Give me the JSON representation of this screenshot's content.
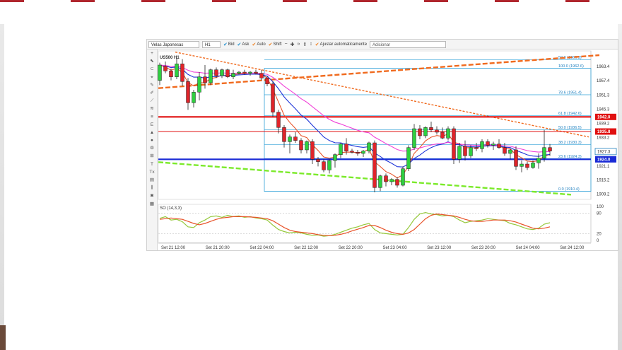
{
  "colors": {
    "bull": "#2fd040",
    "bear": "#e0242a",
    "ma_fast": "#e8532a",
    "ma_mid": "#2036d8",
    "ma_slow": "#f043d8",
    "fib": "#2fa0d8",
    "support_line": "#1a2bd6",
    "resistance_line": "#e01010",
    "trend_green": "#7bea2a",
    "trend_orange": "#f06a1e",
    "stoch_k": "#95c83a",
    "stoch_d": "#e8532a"
  },
  "toolbar": {
    "chart_type": "Velas Japonesas",
    "timeframe": "H1",
    "bid": "Bid",
    "ask": "Ask",
    "auto": "Auto",
    "shift": "Shift",
    "autofit": "Ajustar automaticamente",
    "add_placeholder": "Adicionar",
    "icons": [
      "zoom-out-icon",
      "zoom-in-icon",
      "scroll-end-icon",
      "fit-vertical-icon",
      "fit-both-icon"
    ]
  },
  "tools": [
    "plus-icon",
    "cursor-icon",
    "magnet-icon",
    "crosshair-icon",
    "pencil-icon",
    "brush-icon",
    "line-icon",
    "channel-icon",
    "fib-icon",
    "E",
    "up-arrow-icon",
    "dot-icon",
    "gear-icon",
    "ruler-icon",
    "T",
    "Tx",
    "layers-icon",
    "bars-icon",
    "camera-icon",
    "grid-icon"
  ],
  "chart_data": {
    "type": "candlestick",
    "symbol": "US500 H1",
    "y_axis_ticks": [
      "1963.4",
      "1957.4",
      "1951.3",
      "1945.3",
      "1939.2",
      "1933.2",
      "1927.1",
      "1921.1",
      "1915.2",
      "1909.2"
    ],
    "ylim": [
      1907,
      1970
    ],
    "x_tick_labels": [
      "Set 21 12:00",
      "Set 21 20:00",
      "Set 22 04:00",
      "Set 22 12:00",
      "Set 22 20:00",
      "Set 23 04:00",
      "Set 23 12:00",
      "Set 23 20:00",
      "Set 24 04:00",
      "Set 24 12:00"
    ],
    "price_tags": [
      {
        "value": 1942.0,
        "label": "1942.0",
        "color": "#e01010"
      },
      {
        "value": 1935.8,
        "label": "1935.8",
        "color": "#e01010"
      },
      {
        "value": 1927.3,
        "label": "1927.3",
        "color": "#1e7fbf",
        "outlined": true
      },
      {
        "value": 1924.0,
        "label": "1924.0",
        "color": "#1a2bd6"
      }
    ],
    "horizontal_lines": [
      {
        "value": 1942.0,
        "color": "#e01010",
        "width": 2.2
      },
      {
        "value": 1935.8,
        "color": "#e01010",
        "width": 1
      },
      {
        "value": 1924.0,
        "color": "#1a2bd6",
        "width": 2.2
      }
    ],
    "fibonacci": [
      {
        "level": "50.0",
        "value": 1966.3,
        "label": "50.0 (1966.3)"
      },
      {
        "level": "100.0",
        "value": 1962.6,
        "label": "100.0 (1962.6)"
      },
      {
        "level": "78.6",
        "value": 1951.4,
        "label": "78.6 (1951.4)"
      },
      {
        "level": "61.8",
        "value": 1942.6,
        "label": "61.8 (1942.6)"
      },
      {
        "level": "50.0",
        "value": 1936.5,
        "label": "50.0 (1936.5)"
      },
      {
        "level": "38.2",
        "value": 1930.3,
        "label": "38.2 (1930.3)"
      },
      {
        "level": "23.6",
        "value": 1924.3,
        "label": "23.6 (1924.3)"
      },
      {
        "level": "0.0",
        "value": 1910.4,
        "label": "0.0 (1910.4)"
      }
    ],
    "candles": [
      {
        "o": 1957.5,
        "h": 1965.0,
        "l": 1955.5,
        "c": 1964.0
      },
      {
        "o": 1963.5,
        "h": 1965.5,
        "l": 1960.5,
        "c": 1961.5
      },
      {
        "o": 1961.5,
        "h": 1962.5,
        "l": 1957.5,
        "c": 1959.0
      },
      {
        "o": 1959.0,
        "h": 1967.0,
        "l": 1958.0,
        "c": 1964.5
      },
      {
        "o": 1964.5,
        "h": 1966.5,
        "l": 1955.0,
        "c": 1957.0
      },
      {
        "o": 1957.0,
        "h": 1958.5,
        "l": 1945.0,
        "c": 1948.0
      },
      {
        "o": 1948.0,
        "h": 1953.5,
        "l": 1946.0,
        "c": 1952.5
      },
      {
        "o": 1952.5,
        "h": 1961.0,
        "l": 1949.0,
        "c": 1959.0
      },
      {
        "o": 1959.0,
        "h": 1964.0,
        "l": 1954.0,
        "c": 1956.5
      },
      {
        "o": 1956.5,
        "h": 1962.5,
        "l": 1955.5,
        "c": 1962.0
      },
      {
        "o": 1962.0,
        "h": 1963.0,
        "l": 1958.5,
        "c": 1959.5
      },
      {
        "o": 1959.5,
        "h": 1962.5,
        "l": 1958.5,
        "c": 1962.0
      },
      {
        "o": 1962.0,
        "h": 1962.5,
        "l": 1958.5,
        "c": 1959.0
      },
      {
        "o": 1959.0,
        "h": 1962.0,
        "l": 1958.0,
        "c": 1960.5
      },
      {
        "o": 1960.5,
        "h": 1961.5,
        "l": 1960.0,
        "c": 1961.0
      },
      {
        "o": 1961.0,
        "h": 1962.0,
        "l": 1960.0,
        "c": 1960.5
      },
      {
        "o": 1960.5,
        "h": 1961.5,
        "l": 1959.5,
        "c": 1961.0
      },
      {
        "o": 1961.0,
        "h": 1962.0,
        "l": 1960.0,
        "c": 1960.5
      },
      {
        "o": 1960.5,
        "h": 1962.0,
        "l": 1957.5,
        "c": 1958.5
      },
      {
        "o": 1958.5,
        "h": 1959.5,
        "l": 1955.0,
        "c": 1956.0
      },
      {
        "o": 1956.0,
        "h": 1957.0,
        "l": 1942.0,
        "c": 1944.0
      },
      {
        "o": 1944.0,
        "h": 1945.0,
        "l": 1935.0,
        "c": 1937.5
      },
      {
        "o": 1937.5,
        "h": 1938.5,
        "l": 1929.0,
        "c": 1931.5
      },
      {
        "o": 1931.5,
        "h": 1934.5,
        "l": 1926.5,
        "c": 1933.5
      },
      {
        "o": 1933.5,
        "h": 1935.5,
        "l": 1931.0,
        "c": 1932.0
      },
      {
        "o": 1932.0,
        "h": 1933.0,
        "l": 1926.5,
        "c": 1928.0
      },
      {
        "o": 1928.0,
        "h": 1932.0,
        "l": 1926.5,
        "c": 1931.5
      },
      {
        "o": 1931.5,
        "h": 1932.5,
        "l": 1922.0,
        "c": 1924.0
      },
      {
        "o": 1924.0,
        "h": 1925.0,
        "l": 1921.0,
        "c": 1923.0
      },
      {
        "o": 1923.0,
        "h": 1924.0,
        "l": 1918.5,
        "c": 1919.5
      },
      {
        "o": 1919.5,
        "h": 1924.0,
        "l": 1918.0,
        "c": 1923.5
      },
      {
        "o": 1923.5,
        "h": 1926.5,
        "l": 1920.5,
        "c": 1926.0
      },
      {
        "o": 1926.0,
        "h": 1931.0,
        "l": 1924.5,
        "c": 1930.5
      },
      {
        "o": 1930.5,
        "h": 1933.0,
        "l": 1926.0,
        "c": 1927.5
      },
      {
        "o": 1927.5,
        "h": 1928.5,
        "l": 1926.5,
        "c": 1927.0
      },
      {
        "o": 1927.0,
        "h": 1928.0,
        "l": 1925.5,
        "c": 1926.5
      },
      {
        "o": 1926.5,
        "h": 1928.0,
        "l": 1925.0,
        "c": 1927.5
      },
      {
        "o": 1927.5,
        "h": 1931.5,
        "l": 1926.5,
        "c": 1931.0
      },
      {
        "o": 1931.0,
        "h": 1932.0,
        "l": 1910.0,
        "c": 1912.0
      },
      {
        "o": 1912.0,
        "h": 1917.5,
        "l": 1910.5,
        "c": 1917.0
      },
      {
        "o": 1917.0,
        "h": 1918.0,
        "l": 1912.5,
        "c": 1914.5
      },
      {
        "o": 1914.5,
        "h": 1916.0,
        "l": 1913.0,
        "c": 1915.5
      },
      {
        "o": 1915.5,
        "h": 1916.5,
        "l": 1912.0,
        "c": 1913.0
      },
      {
        "o": 1913.0,
        "h": 1921.0,
        "l": 1912.5,
        "c": 1920.0
      },
      {
        "o": 1920.0,
        "h": 1930.0,
        "l": 1919.0,
        "c": 1929.0
      },
      {
        "o": 1929.0,
        "h": 1939.0,
        "l": 1928.0,
        "c": 1937.0
      },
      {
        "o": 1937.0,
        "h": 1938.5,
        "l": 1932.5,
        "c": 1934.0
      },
      {
        "o": 1934.0,
        "h": 1938.0,
        "l": 1933.0,
        "c": 1937.5
      },
      {
        "o": 1937.5,
        "h": 1940.0,
        "l": 1935.5,
        "c": 1936.5
      },
      {
        "o": 1936.5,
        "h": 1938.0,
        "l": 1934.5,
        "c": 1935.5
      },
      {
        "o": 1935.5,
        "h": 1937.5,
        "l": 1932.5,
        "c": 1933.0
      },
      {
        "o": 1933.0,
        "h": 1938.0,
        "l": 1932.0,
        "c": 1937.0
      },
      {
        "o": 1937.0,
        "h": 1938.0,
        "l": 1922.0,
        "c": 1924.0
      },
      {
        "o": 1924.0,
        "h": 1931.0,
        "l": 1922.5,
        "c": 1929.5
      },
      {
        "o": 1929.5,
        "h": 1932.0,
        "l": 1923.5,
        "c": 1925.5
      },
      {
        "o": 1925.5,
        "h": 1930.0,
        "l": 1924.5,
        "c": 1929.0
      },
      {
        "o": 1929.0,
        "h": 1931.0,
        "l": 1927.5,
        "c": 1928.5
      },
      {
        "o": 1928.5,
        "h": 1932.5,
        "l": 1927.0,
        "c": 1931.5
      },
      {
        "o": 1931.5,
        "h": 1932.5,
        "l": 1929.0,
        "c": 1930.0
      },
      {
        "o": 1930.0,
        "h": 1931.5,
        "l": 1928.0,
        "c": 1930.5
      },
      {
        "o": 1930.5,
        "h": 1932.5,
        "l": 1928.5,
        "c": 1929.0
      },
      {
        "o": 1929.0,
        "h": 1931.0,
        "l": 1925.5,
        "c": 1926.5
      },
      {
        "o": 1926.5,
        "h": 1928.5,
        "l": 1924.0,
        "c": 1928.0
      },
      {
        "o": 1928.0,
        "h": 1929.5,
        "l": 1919.5,
        "c": 1921.0
      },
      {
        "o": 1921.0,
        "h": 1923.5,
        "l": 1918.5,
        "c": 1922.0
      },
      {
        "o": 1922.0,
        "h": 1923.0,
        "l": 1919.5,
        "c": 1920.5
      },
      {
        "o": 1920.5,
        "h": 1923.5,
        "l": 1920.0,
        "c": 1922.5
      },
      {
        "o": 1922.5,
        "h": 1926.5,
        "l": 1920.0,
        "c": 1924.5
      },
      {
        "o": 1924.5,
        "h": 1936.5,
        "l": 1923.0,
        "c": 1929.0
      },
      {
        "o": 1929.0,
        "h": 1930.5,
        "l": 1925.5,
        "c": 1927.5
      }
    ],
    "stochastic": {
      "label": "SO (14,3,3)",
      "ylim": [
        0,
        100
      ],
      "ticks": [
        "100",
        "80",
        "20",
        "0"
      ],
      "k": [
        65,
        70,
        60,
        62,
        55,
        40,
        38,
        52,
        60,
        70,
        72,
        68,
        74,
        70,
        72,
        68,
        70,
        66,
        64,
        60,
        45,
        32,
        26,
        22,
        24,
        22,
        18,
        15,
        16,
        12,
        14,
        18,
        24,
        30,
        36,
        40,
        46,
        50,
        32,
        22,
        20,
        18,
        16,
        18,
        38,
        62,
        78,
        82,
        78,
        76,
        72,
        74,
        70,
        60,
        52,
        56,
        58,
        60,
        64,
        62,
        60,
        58,
        50,
        46,
        40,
        34,
        32,
        36,
        48,
        52
      ],
      "d": [
        62,
        64,
        66,
        64,
        62,
        56,
        50,
        46,
        50,
        56,
        62,
        66,
        68,
        70,
        70,
        70,
        69,
        68,
        66,
        64,
        58,
        48,
        38,
        30,
        26,
        24,
        22,
        20,
        17,
        15,
        14,
        15,
        18,
        22,
        28,
        33,
        38,
        44,
        44,
        38,
        30,
        24,
        20,
        18,
        22,
        32,
        48,
        64,
        74,
        78,
        76,
        74,
        72,
        68,
        62,
        58,
        56,
        56,
        58,
        60,
        60,
        60,
        58,
        54,
        48,
        42,
        36,
        34,
        36,
        40
      ]
    }
  }
}
